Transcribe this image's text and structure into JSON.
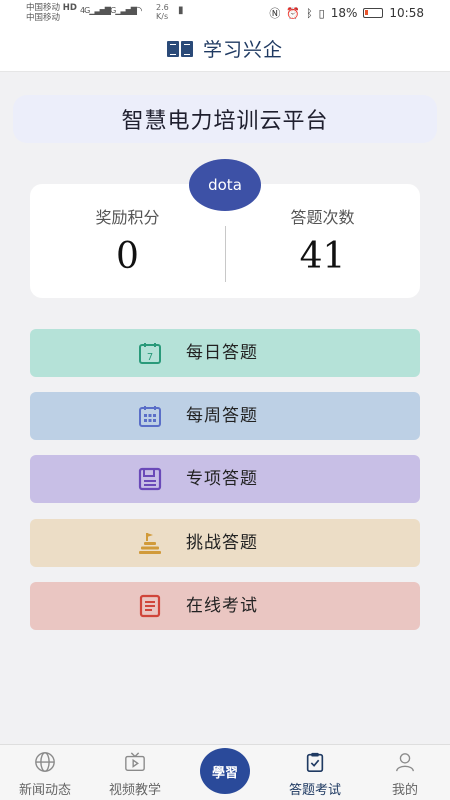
{
  "status_bar": {
    "carrier_1": "中国移动",
    "carrier_1_tag": "HD",
    "carrier_2": "中国移动",
    "signal_1": "4G",
    "signal_2": "2G",
    "speed_value": "2.6",
    "speed_unit": "K/s",
    "battery": "18%",
    "time": "10:58"
  },
  "header": {
    "title": "学习兴企"
  },
  "banner": {
    "text": "智慧电力培训云平台"
  },
  "profile": {
    "avatar_text": "dota",
    "points_label": "奖励积分",
    "points_value": "0",
    "answers_label": "答题次数",
    "answers_value": "41"
  },
  "menu": [
    {
      "label": "每日答题",
      "icon": "calendar-7-icon",
      "color": "#b5e2d8",
      "icon_color": "#2a9a7a"
    },
    {
      "label": "每周答题",
      "icon": "calendar-grid-icon",
      "color": "#bdd0e5",
      "icon_color": "#5a6ec8"
    },
    {
      "label": "专项答题",
      "icon": "floppy-icon",
      "color": "#c8bfe6",
      "icon_color": "#6a4ab8"
    },
    {
      "label": "挑战答题",
      "icon": "podium-icon",
      "color": "#ecddc6",
      "icon_color": "#d19a3a"
    },
    {
      "label": "在线考试",
      "icon": "document-icon",
      "color": "#eac6c2",
      "icon_color": "#d0453a"
    }
  ],
  "bottom_nav": {
    "items": [
      {
        "label": "新闻动态",
        "icon": "globe-icon"
      },
      {
        "label": "视频教学",
        "icon": "tv-icon"
      },
      {
        "label": "答题考试",
        "icon": "clipboard-check-icon",
        "active": true
      },
      {
        "label": "我的",
        "icon": "user-icon"
      }
    ],
    "center_logo": "學習"
  }
}
